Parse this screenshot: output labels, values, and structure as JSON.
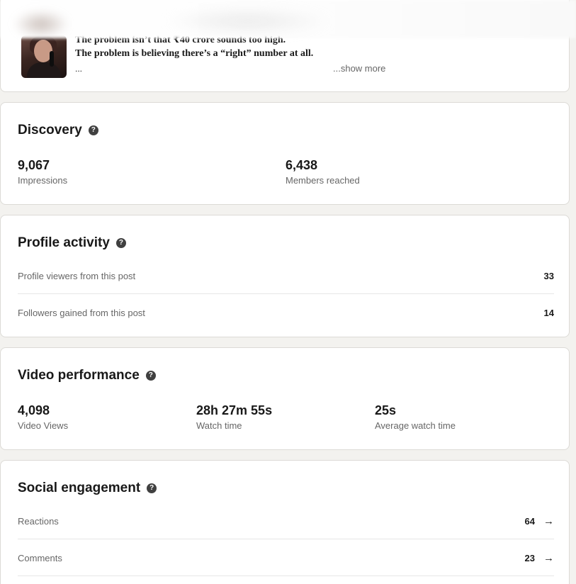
{
  "post": {
    "line1": "The problem isn’t that ₹40 crore sounds too high.",
    "line2": "The problem is believing there’s a “right” number at all.",
    "ellipsis": "...",
    "show_more": "...show more"
  },
  "discovery": {
    "title": "Discovery",
    "stats": [
      {
        "value": "9,067",
        "label": "Impressions"
      },
      {
        "value": "6,438",
        "label": "Members reached"
      }
    ]
  },
  "profile_activity": {
    "title": "Profile activity",
    "rows": [
      {
        "label": "Profile viewers from this post",
        "value": "33"
      },
      {
        "label": "Followers gained from this post",
        "value": "14"
      }
    ]
  },
  "video_performance": {
    "title": "Video performance",
    "stats": [
      {
        "value": "4,098",
        "label": "Video Views"
      },
      {
        "value": "28h 27m 55s",
        "label": "Watch time"
      },
      {
        "value": "25s",
        "label": "Average watch time"
      }
    ]
  },
  "social_engagement": {
    "title": "Social engagement",
    "rows": [
      {
        "label": "Reactions",
        "value": "64"
      },
      {
        "label": "Comments",
        "value": "23"
      }
    ]
  },
  "icons": {
    "help": "question-circle-icon",
    "arrow": "arrow-right-icon"
  },
  "colors": {
    "background": "#f3f2ef",
    "card": "#ffffff",
    "text_primary": "#191919",
    "text_secondary": "#666666"
  }
}
